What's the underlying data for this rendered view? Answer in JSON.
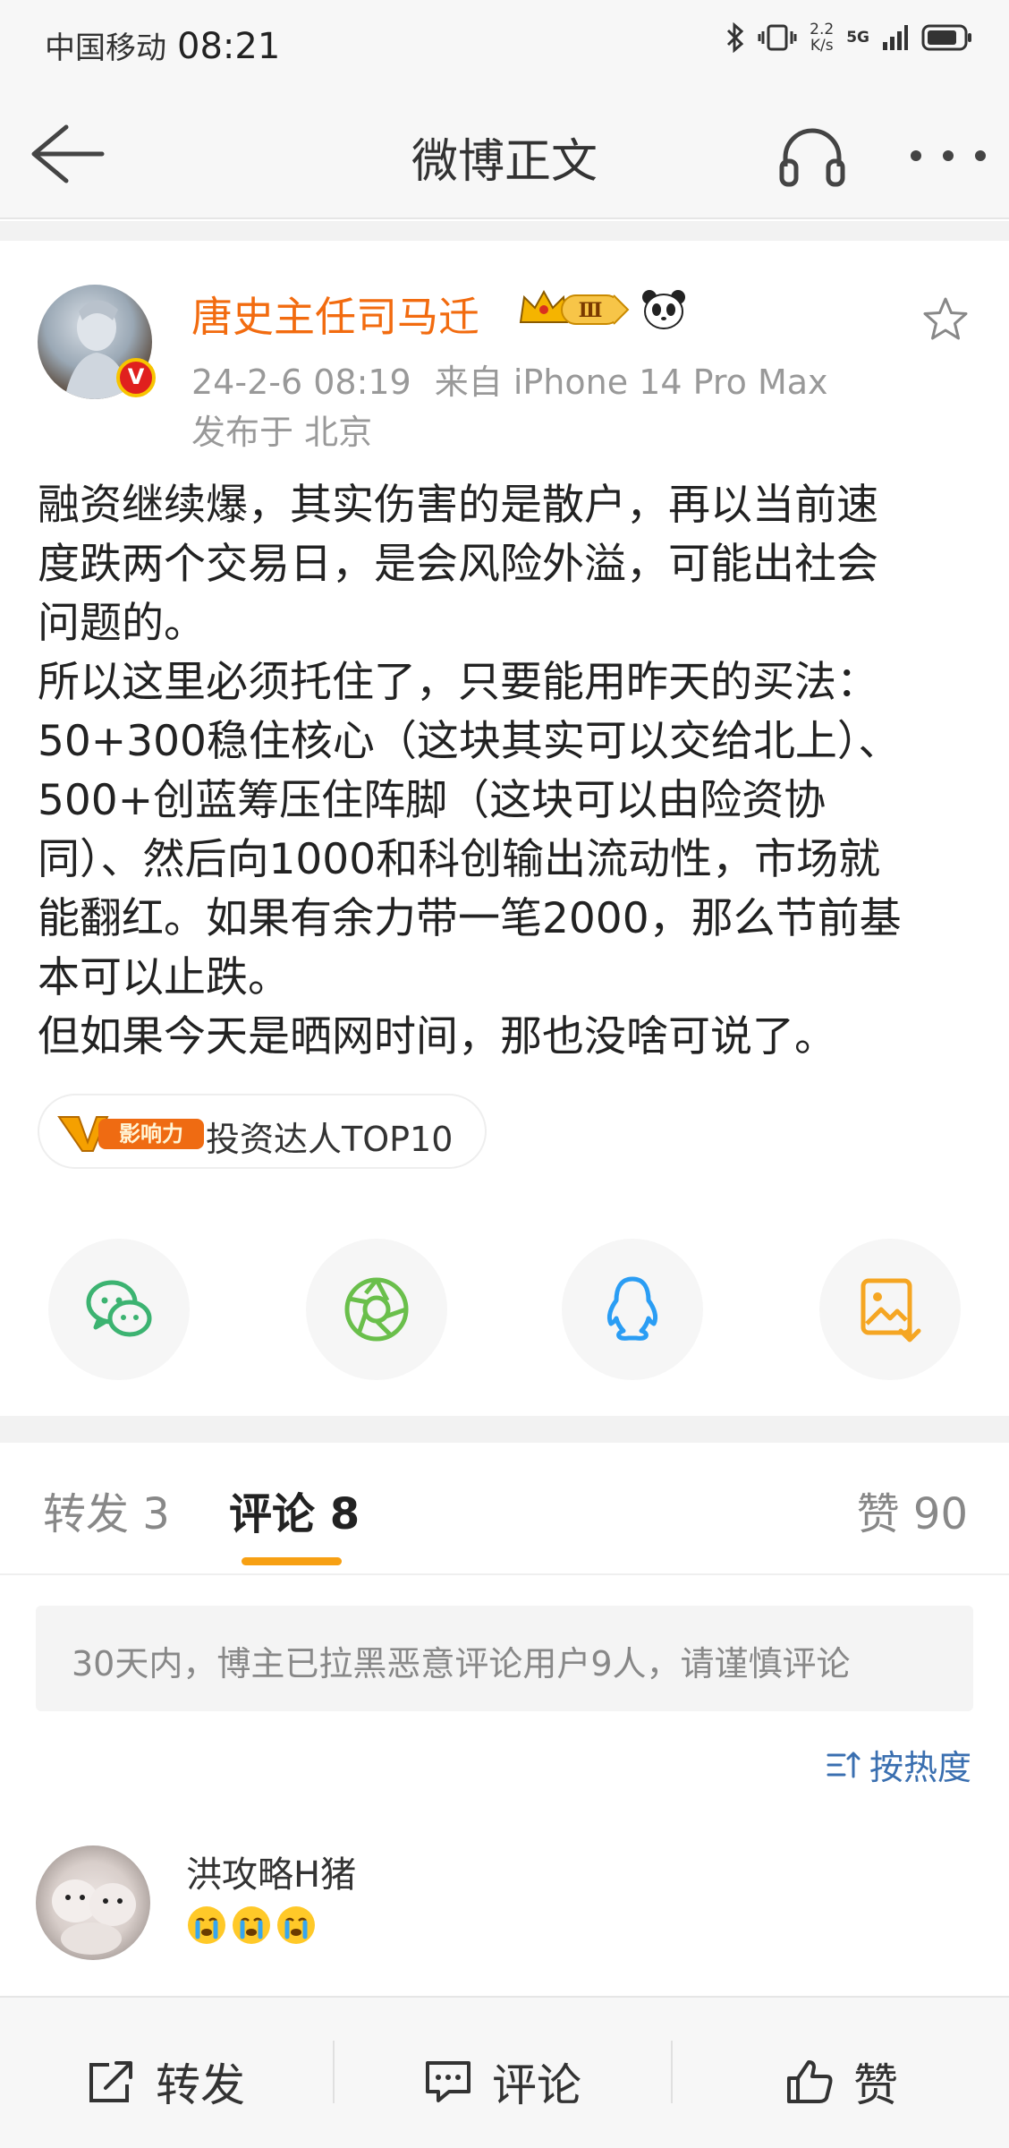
{
  "status_bar": {
    "carrier": "中国移动",
    "time": "08:21",
    "net_speed_value": "2.2",
    "net_speed_unit": "K/s",
    "network": "5G"
  },
  "nav": {
    "title": "微博正文",
    "back_icon": "back-arrow-icon",
    "headset_icon": "headset-icon",
    "more_icon": "more-dots-icon"
  },
  "post": {
    "author": {
      "name": "唐史主任司马迁",
      "level_badge": "Ⅲ",
      "verified_mark": "V"
    },
    "meta": {
      "date": "24-2-6 08:19",
      "source": "来自 iPhone 14 Pro Max",
      "location": "发布于 北京"
    },
    "body_lines": [
      "融资继续爆，其实伤害的是散户，再以当前速",
      "度跌两个交易日，是会风险外溢，可能出社会",
      "问题的。",
      "所以这里必须托住了，只要能用昨天的买法：",
      "50+300稳住核心（这块其实可以交给北上）、",
      "500+创蓝筹压住阵脚（这块可以由险资协",
      "同）、然后向1000和科创输出流动性，市场就",
      "能翻红。如果有余力带一笔2000，那么节前基",
      "本可以止跌。",
      "但如果今天是晒网时间，那也没啥可说了。"
    ],
    "influence": {
      "badge_text": "影响力",
      "badge_letter": "V",
      "label": "投资达人TOP10"
    }
  },
  "share": [
    {
      "name": "wechat",
      "icon": "wechat-icon",
      "color": "#3cb371"
    },
    {
      "name": "moments",
      "icon": "aperture-icon",
      "color": "#6abf4b"
    },
    {
      "name": "qq",
      "icon": "qq-penguin-icon",
      "color": "#2a9df4"
    },
    {
      "name": "save-image",
      "icon": "save-image-icon",
      "color": "#f5a623"
    }
  ],
  "tabs": {
    "repost": "转发 3",
    "comment": "评论 8",
    "like": "赞 90"
  },
  "notice": "30天内，博主已拉黑恶意评论用户9人，请谨慎评论",
  "sort_label": "按热度",
  "comments": [
    {
      "name": "洪攻略H猪",
      "emojis": [
        "cry-emoji",
        "cry-emoji",
        "cry-emoji"
      ]
    }
  ],
  "bottom_bar": {
    "repost": "转发",
    "comment": "评论",
    "like": "赞"
  },
  "colors": {
    "accent_orange": "#f26b0f",
    "tab_underline": "#f7a013",
    "link_blue": "#3a6fb0"
  }
}
